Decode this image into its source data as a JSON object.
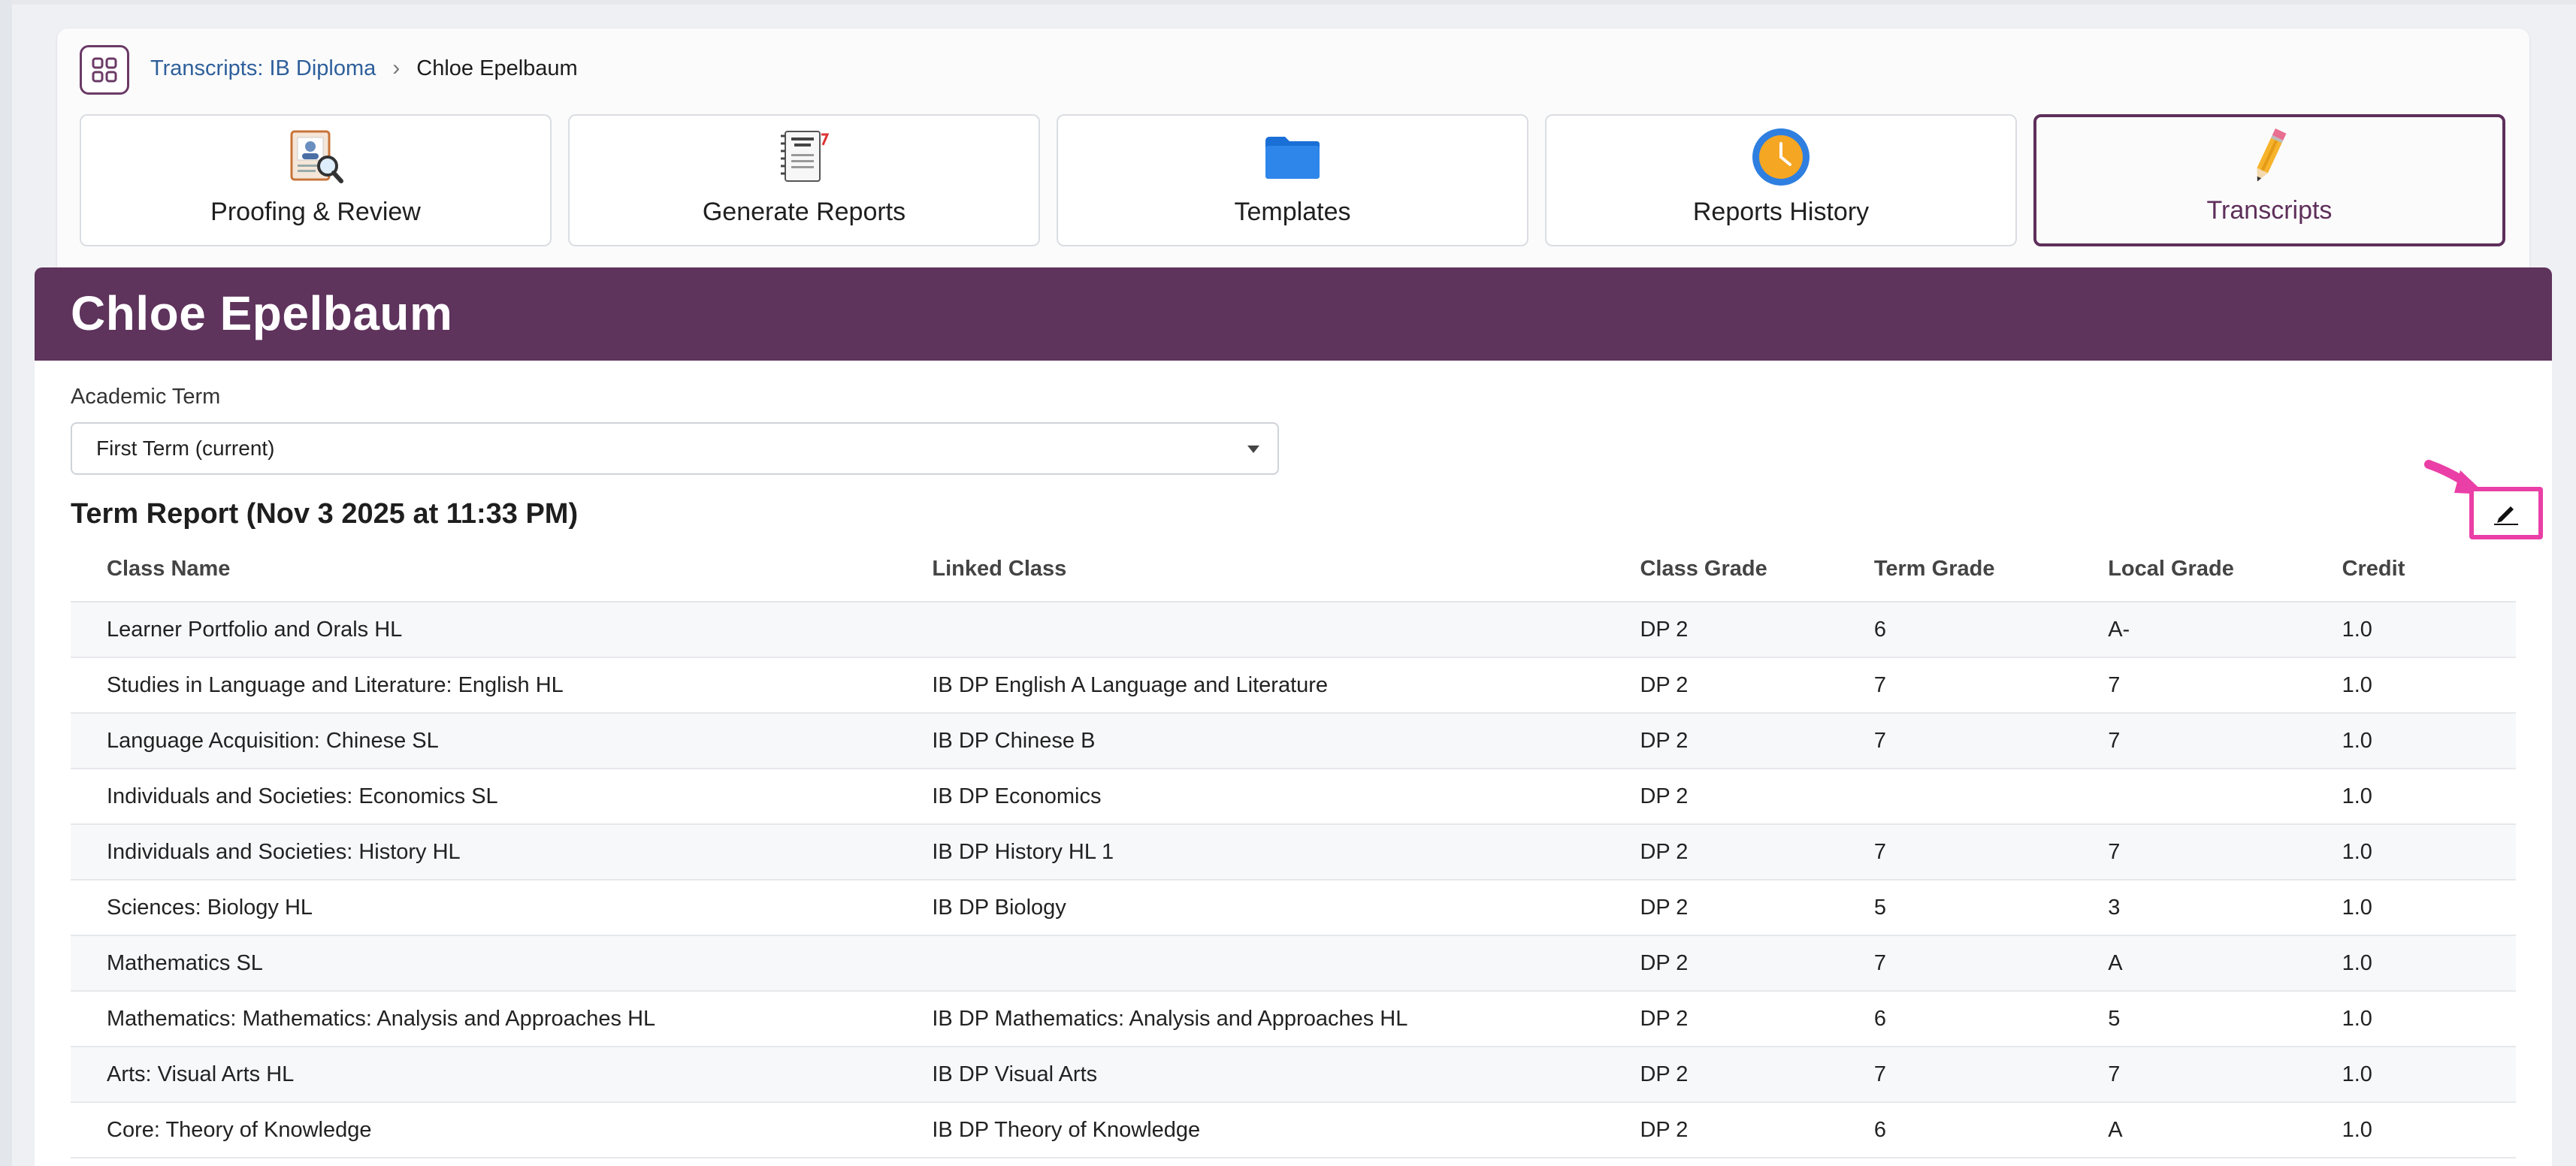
{
  "breadcrumb": {
    "parent": "Transcripts: IB Diploma",
    "current": "Chloe Epelbaum"
  },
  "tiles": [
    {
      "label": "Proofing & Review",
      "icon": "proofing-icon"
    },
    {
      "label": "Generate Reports",
      "icon": "report-cards-icon"
    },
    {
      "label": "Templates",
      "icon": "folder-icon"
    },
    {
      "label": "Reports History",
      "icon": "clock-icon"
    },
    {
      "label": "Transcripts",
      "icon": "pencil-icon",
      "active": true
    }
  ],
  "student": {
    "name": "Chloe Epelbaum"
  },
  "term": {
    "label": "Academic Term",
    "selected": "First Term (current)"
  },
  "report": {
    "title": "Term Report (Nov 3 2025 at 11:33 PM)",
    "columns": [
      "Class Name",
      "Linked Class",
      "Class Grade",
      "Term Grade",
      "Local Grade",
      "Credit"
    ],
    "rows": [
      [
        "Learner Portfolio and Orals HL",
        "",
        "DP 2",
        "6",
        "A-",
        "1.0"
      ],
      [
        "Studies in Language and Literature: English HL",
        "IB DP English A Language and Literature",
        "DP 2",
        "7",
        "7",
        "1.0"
      ],
      [
        "Language Acquisition: Chinese SL",
        "IB DP Chinese B",
        "DP 2",
        "7",
        "7",
        "1.0"
      ],
      [
        "Individuals and Societies: Economics SL",
        "IB DP Economics",
        "DP 2",
        "",
        "",
        "1.0"
      ],
      [
        "Individuals and Societies: History HL",
        "IB DP History HL 1",
        "DP 2",
        "7",
        "7",
        "1.0"
      ],
      [
        "Sciences: Biology HL",
        "IB DP Biology",
        "DP 2",
        "5",
        "3",
        "1.0"
      ],
      [
        "Mathematics SL",
        "",
        "DP 2",
        "7",
        "A",
        "1.0"
      ],
      [
        "Mathematics: Mathematics: Analysis and Approaches HL",
        "IB DP Mathematics: Analysis and Approaches HL",
        "DP 2",
        "6",
        "5",
        "1.0"
      ],
      [
        "Arts: Visual Arts HL",
        "IB DP Visual Arts",
        "DP 2",
        "7",
        "7",
        "1.0"
      ],
      [
        "Core: Theory of Knowledge",
        "IB DP Theory of Knowledge",
        "DP 2",
        "6",
        "A",
        "1.0"
      ]
    ]
  },
  "colors": {
    "brand_purple": "#5e335c",
    "highlight_pink": "#ea3fa6",
    "link_blue": "#2e5f9a"
  }
}
